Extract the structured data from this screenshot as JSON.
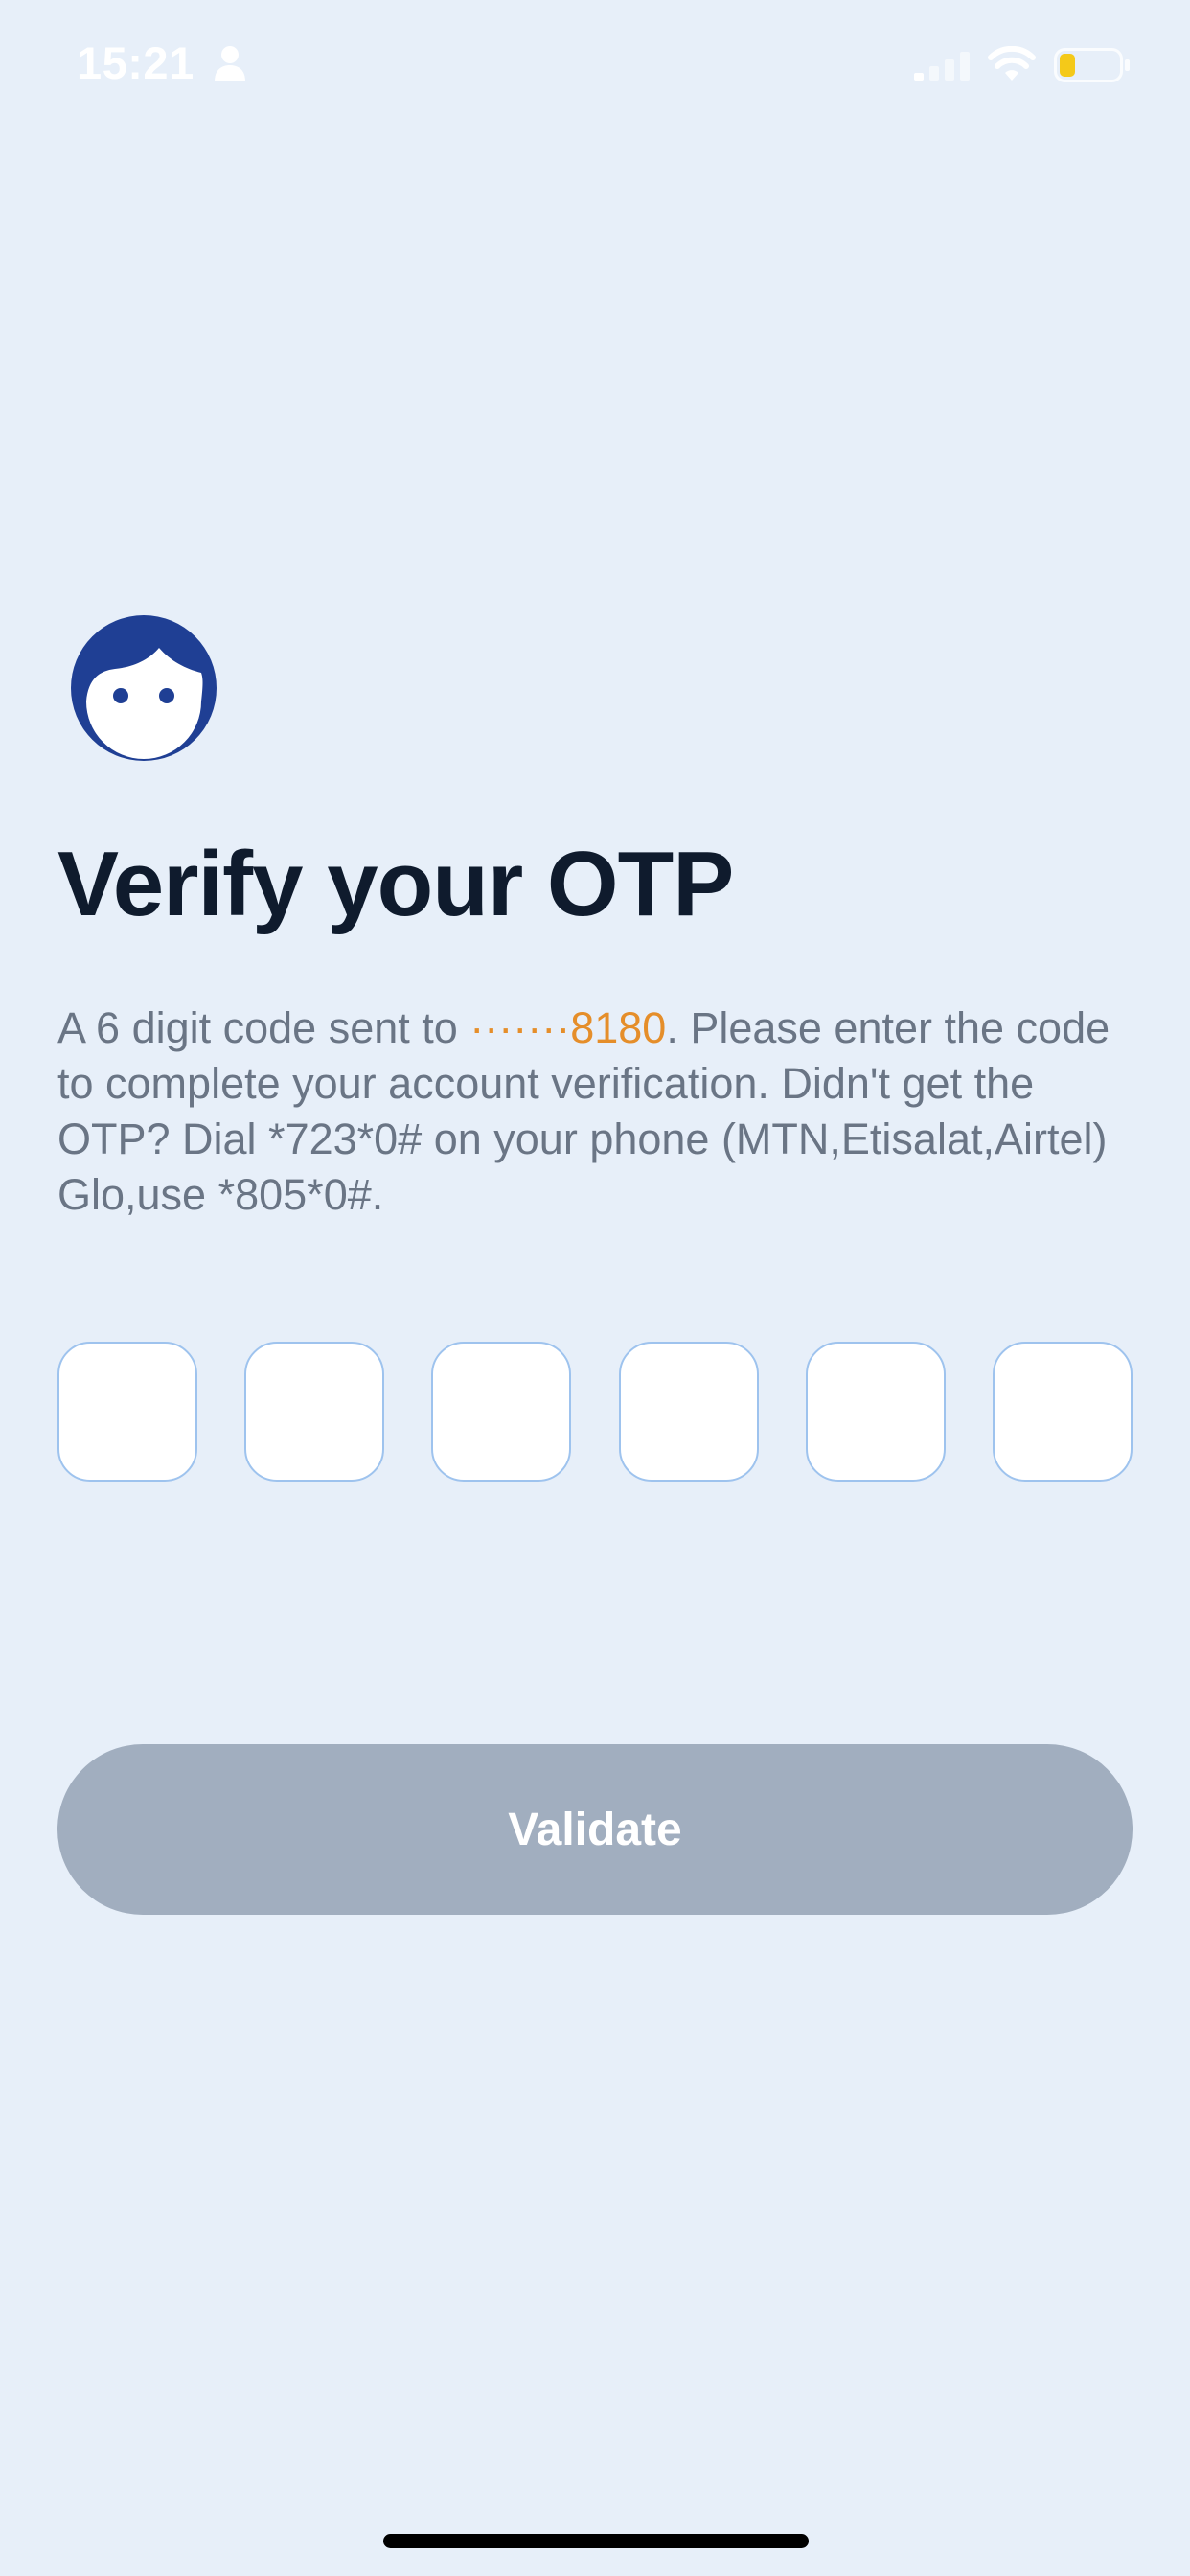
{
  "status_bar": {
    "time": "15:21",
    "icons": [
      "person-icon",
      "signal-icon",
      "wifi-icon",
      "battery-icon"
    ]
  },
  "avatar": {
    "icon": "face-icon",
    "color": "#1f3f94"
  },
  "page": {
    "title": "Verify your OTP",
    "description_prefix": "A 6 digit code sent to ",
    "masked_phone": "·······8180",
    "description_suffix": ". Please enter the code to complete your account verification. Didn't get the OTP? Dial *723*0# on your phone (MTN,Etisalat,Airtel) Glo,use *805*0#."
  },
  "otp": {
    "length": 6,
    "values": [
      "",
      "",
      "",
      "",
      "",
      ""
    ]
  },
  "validate_button": {
    "label": "Validate",
    "enabled": false
  },
  "colors": {
    "background": "#e7eff9",
    "title": "#0f1b2d",
    "body_text": "#6a7585",
    "accent": "#e58e2a",
    "button_disabled": "#a1aebf",
    "otp_border": "#9ec3ee"
  }
}
